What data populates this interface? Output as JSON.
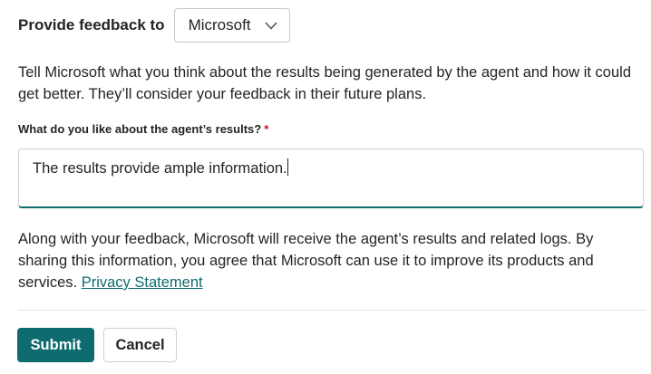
{
  "header": {
    "label": "Provide feedback to",
    "recipient_selected": "Microsoft"
  },
  "intro_text": "Tell Microsoft what you think about the results being generated by the agent and how it could get better. They’ll consider your feedback in their future plans.",
  "question": {
    "label": "What do you like about the agent’s results?",
    "required_marker": "*",
    "value": "The results provide ample information."
  },
  "notice": {
    "text": "Along with your feedback, Microsoft will receive the agent’s results and related logs. By sharing this information, you agree that Microsoft can use it to improve its products and services.",
    "link_text": "Privacy Statement"
  },
  "buttons": {
    "submit": "Submit",
    "cancel": "Cancel"
  },
  "colors": {
    "accent": "#0f6c6e",
    "required": "#c50f1f",
    "text": "#242424"
  },
  "icons": {
    "dropdown": "chevron-down-icon"
  }
}
